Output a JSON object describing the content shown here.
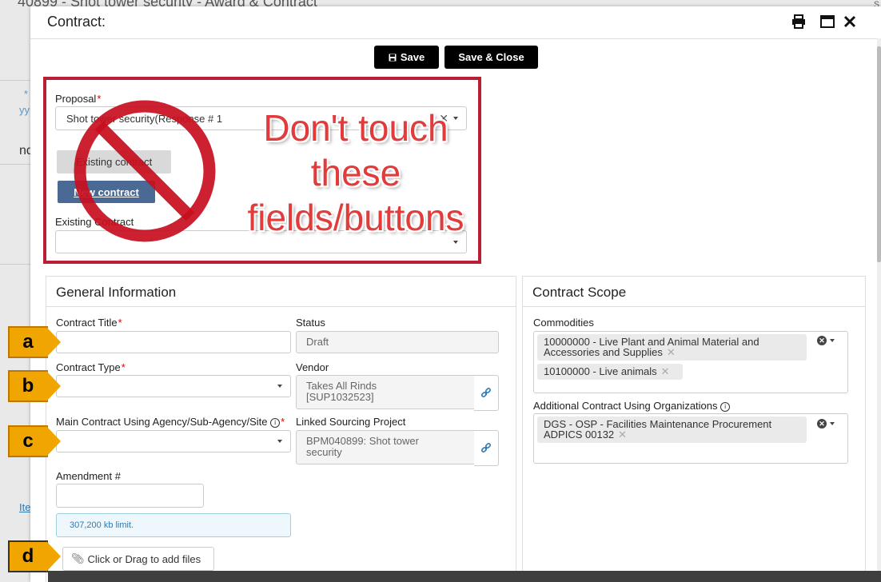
{
  "background": {
    "page_title": "40899 - Shot tower security - Award & Contract",
    "right_fragment": "s",
    "left_fragments": [
      "* a",
      "yy",
      "nd",
      "Ite"
    ]
  },
  "modal": {
    "title": "Contract:",
    "header_icons": [
      "print-icon",
      "maximize-icon",
      "close-icon"
    ],
    "toolbar": {
      "save_label": "Save",
      "save_close_label": "Save & Close"
    }
  },
  "proposal_section": {
    "proposal_label": "Proposal",
    "proposal_value": "Shot tower security(Response # 1",
    "existing_contract_button": "Existing contract",
    "new_contract_button": "New contract",
    "existing_contract_label": "Existing Contract",
    "existing_contract_value": ""
  },
  "warning": {
    "line1": "Don't touch",
    "line2": "these",
    "line3": "fields/buttons"
  },
  "general_information": {
    "title": "General Information",
    "contract_title_label": "Contract Title",
    "contract_title_value": "",
    "status_label": "Status",
    "status_value": "Draft",
    "contract_type_label": "Contract Type",
    "contract_type_value": "",
    "vendor_label": "Vendor",
    "vendor_value_line1": "Takes All Rinds",
    "vendor_value_line2": "[SUP1032523]",
    "agency_label": "Main Contract Using Agency/Sub-Agency/Site",
    "agency_value": "",
    "linked_project_label": "Linked Sourcing Project",
    "linked_project_line1": "BPM040899: Shot tower",
    "linked_project_line2": "security",
    "amendment_label": "Amendment #",
    "amendment_value": "",
    "file_limit": "307,200 kb limit.",
    "add_files": "Click or Drag to add files"
  },
  "contract_scope": {
    "title": "Contract Scope",
    "commodities_label": "Commodities",
    "commodities": [
      {
        "line1": "10000000 - Live Plant and Animal Material and",
        "line2": "Accessories and Supplies"
      },
      {
        "line1": "10100000 - Live animals",
        "line2": ""
      }
    ],
    "orgs_label": "Additional Contract Using Organizations",
    "orgs": [
      {
        "line1": "DGS - OSP - Facilities Maintenance Procurement",
        "line2": "ADPICS 00132"
      }
    ]
  },
  "callouts": [
    "a",
    "b",
    "c",
    "d"
  ],
  "colors": {
    "warning_red": "#b81f35",
    "callout_orange": "#f0a500",
    "button_black": "#000000",
    "new_contract_blue": "#4a6994"
  }
}
